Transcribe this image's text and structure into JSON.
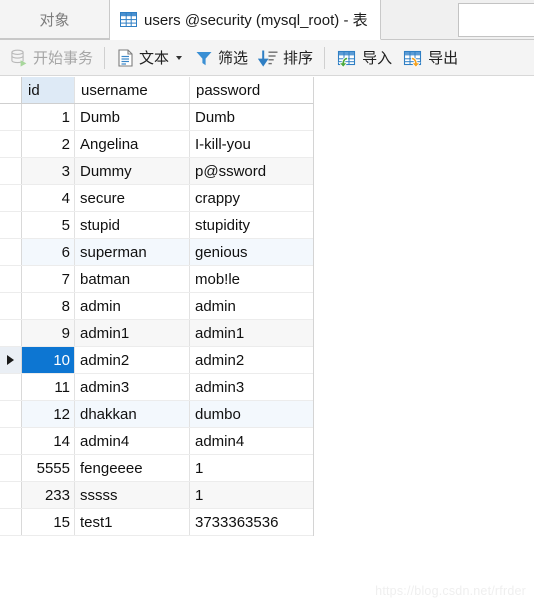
{
  "tabs": {
    "objects_label": "对象",
    "active_label": "users @security (mysql_root) - 表",
    "active_icon": "table-grid-icon"
  },
  "toolbar": {
    "begin_transaction": "开始事务",
    "begin_transaction_icon": "database-run-icon",
    "text": "文本",
    "text_icon": "document-text-icon",
    "filter": "筛选",
    "filter_icon": "funnel-icon",
    "sort": "排序",
    "sort_icon": "sort-descending-icon",
    "import": "导入",
    "import_icon": "table-import-icon",
    "export": "导出",
    "export_icon": "table-export-icon"
  },
  "grid": {
    "columns": [
      "id",
      "username",
      "password"
    ],
    "selected_row_index": 9,
    "selected_column": "id",
    "rows": [
      {
        "id": "1",
        "username": "Dumb",
        "password": "Dumb"
      },
      {
        "id": "2",
        "username": "Angelina",
        "password": "I-kill-you"
      },
      {
        "id": "3",
        "username": "Dummy",
        "password": "p@ssword"
      },
      {
        "id": "4",
        "username": "secure",
        "password": "crappy"
      },
      {
        "id": "5",
        "username": "stupid",
        "password": "stupidity"
      },
      {
        "id": "6",
        "username": "superman",
        "password": "genious"
      },
      {
        "id": "7",
        "username": "batman",
        "password": "mob!le"
      },
      {
        "id": "8",
        "username": "admin",
        "password": "admin"
      },
      {
        "id": "9",
        "username": "admin1",
        "password": "admin1"
      },
      {
        "id": "10",
        "username": "admin2",
        "password": "admin2"
      },
      {
        "id": "11",
        "username": "admin3",
        "password": "admin3"
      },
      {
        "id": "12",
        "username": "dhakkan",
        "password": "dumbo"
      },
      {
        "id": "14",
        "username": "admin4",
        "password": "admin4"
      },
      {
        "id": "5555",
        "username": "fengeeee",
        "password": "1"
      },
      {
        "id": "233",
        "username": "sssss",
        "password": "1"
      },
      {
        "id": "15",
        "username": "test1",
        "password": "3733363536"
      }
    ]
  },
  "watermark": "https://blog.csdn.net/rfrder",
  "colors": {
    "accent_blue": "#0d76d2",
    "header_id_bg": "#deeaf6",
    "stripe_gray": "#f7f7f7",
    "stripe_blue": "#f3f8fd",
    "icon_blue": "#3a87c8",
    "icon_green": "#4aa93a",
    "icon_orange": "#f5a11e"
  }
}
